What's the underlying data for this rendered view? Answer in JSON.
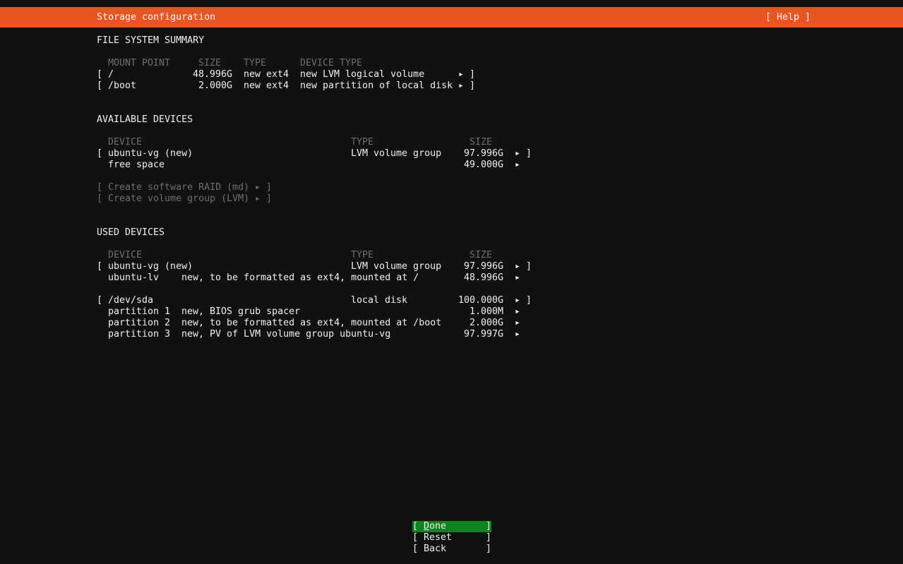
{
  "titlebar": {
    "title": "Storage configuration",
    "help": "[ Help ]"
  },
  "glyphs": {
    "arrow": "▸",
    "bracket_open": "[",
    "bracket_close": "]"
  },
  "file_system_summary": {
    "heading": "FILE SYSTEM SUMMARY",
    "columns": {
      "mount_point": "MOUNT POINT",
      "size": "SIZE",
      "type": "TYPE",
      "device_type": "DEVICE TYPE"
    },
    "rows": [
      {
        "mount_point": "/",
        "size": "48.996G",
        "type": "new ext4",
        "device_type": "new LVM logical volume"
      },
      {
        "mount_point": "/boot",
        "size": "2.000G",
        "type": "new ext4",
        "device_type": "new partition of local disk"
      }
    ]
  },
  "available_devices": {
    "heading": "AVAILABLE DEVICES",
    "columns": {
      "device": "DEVICE",
      "type": "TYPE",
      "size": "SIZE"
    },
    "rows": [
      {
        "device": "ubuntu-vg (new)",
        "type": "LVM volume group",
        "size": "97.996G"
      },
      {
        "device": "free space",
        "type": "",
        "size": "49.000G"
      }
    ],
    "actions": [
      {
        "label": "Create software RAID (md)"
      },
      {
        "label": "Create volume group (LVM)"
      }
    ]
  },
  "used_devices": {
    "heading": "USED DEVICES",
    "columns": {
      "device": "DEVICE",
      "type": "TYPE",
      "size": "SIZE"
    },
    "vg": {
      "device": "ubuntu-vg (new)",
      "type": "LVM volume group",
      "size": "97.996G"
    },
    "lv": {
      "device": "ubuntu-lv",
      "description": "new, to be formatted as ext4, mounted at /",
      "size": "48.996G"
    },
    "disk": {
      "device": "/dev/sda",
      "type": "local disk",
      "size": "100.000G"
    },
    "partitions": [
      {
        "name": "partition 1",
        "description": "new, BIOS grub spacer",
        "size": "1.000M"
      },
      {
        "name": "partition 2",
        "description": "new, to be formatted as ext4, mounted at /boot",
        "size": "2.000G"
      },
      {
        "name": "partition 3",
        "description": "new, PV of LVM volume group ubuntu-vg",
        "size": "97.997G"
      }
    ]
  },
  "buttons": {
    "done": "Done",
    "reset": "Reset",
    "back": "Back"
  },
  "colors": {
    "header_orange": "#E95420",
    "focus_green": "#0E8420",
    "dim_text": "#6E6E6E",
    "background": "#111111",
    "text": "#F0F0F0"
  }
}
